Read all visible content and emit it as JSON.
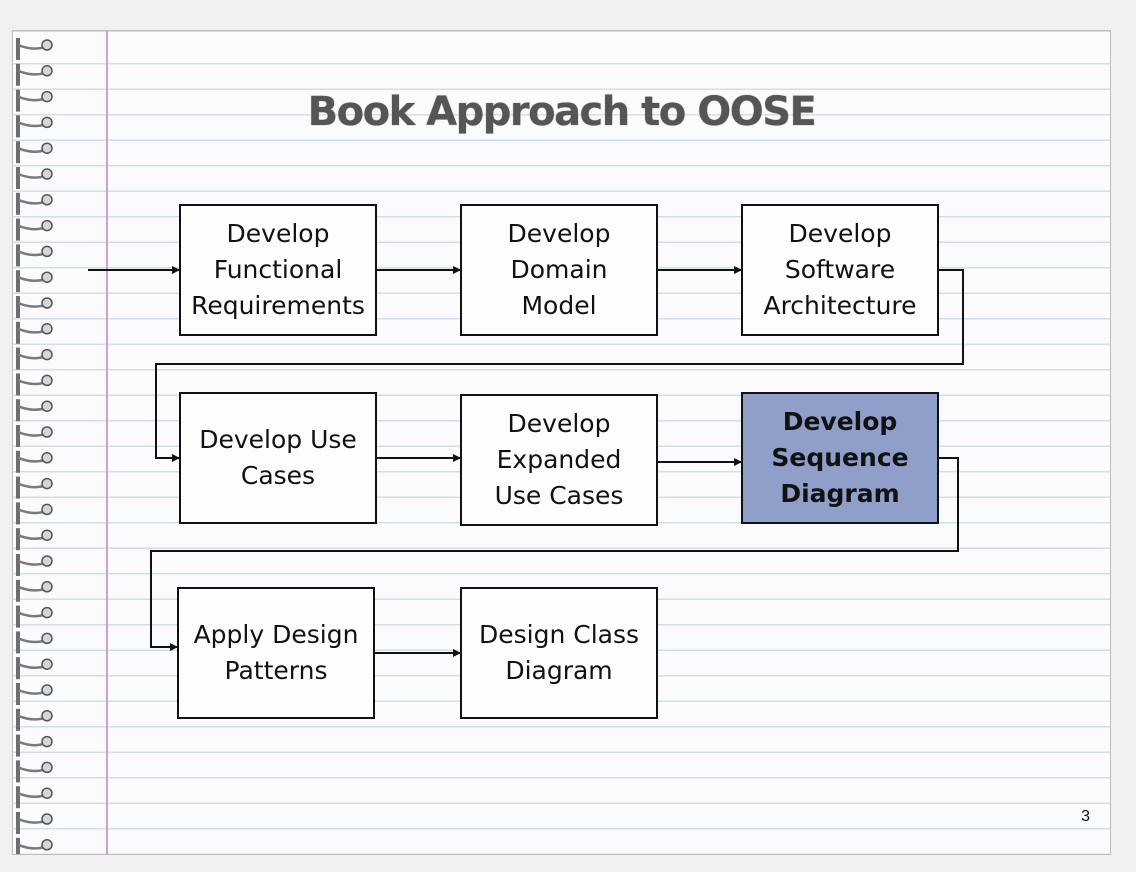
{
  "title": "Book Approach to OOSE",
  "page_number": "3",
  "colors": {
    "highlight_fill": "#8f9fca",
    "rule_line": "#cfe0ec",
    "margin_line": "#c9a3c9"
  },
  "boxes": [
    {
      "label": "Develop\nFunctional\nRequirements"
    },
    {
      "label": "Develop\nDomain\nModel"
    },
    {
      "label": "Develop\nSoftware\nArchitecture"
    },
    {
      "label": "Develop Use\nCases"
    },
    {
      "label": "Develop\nExpanded\nUse Cases"
    },
    {
      "label": "Develop\nSequence\nDiagram",
      "highlighted": true
    },
    {
      "label": "Apply Design\nPatterns"
    },
    {
      "label": "Design Class\nDiagram"
    }
  ]
}
